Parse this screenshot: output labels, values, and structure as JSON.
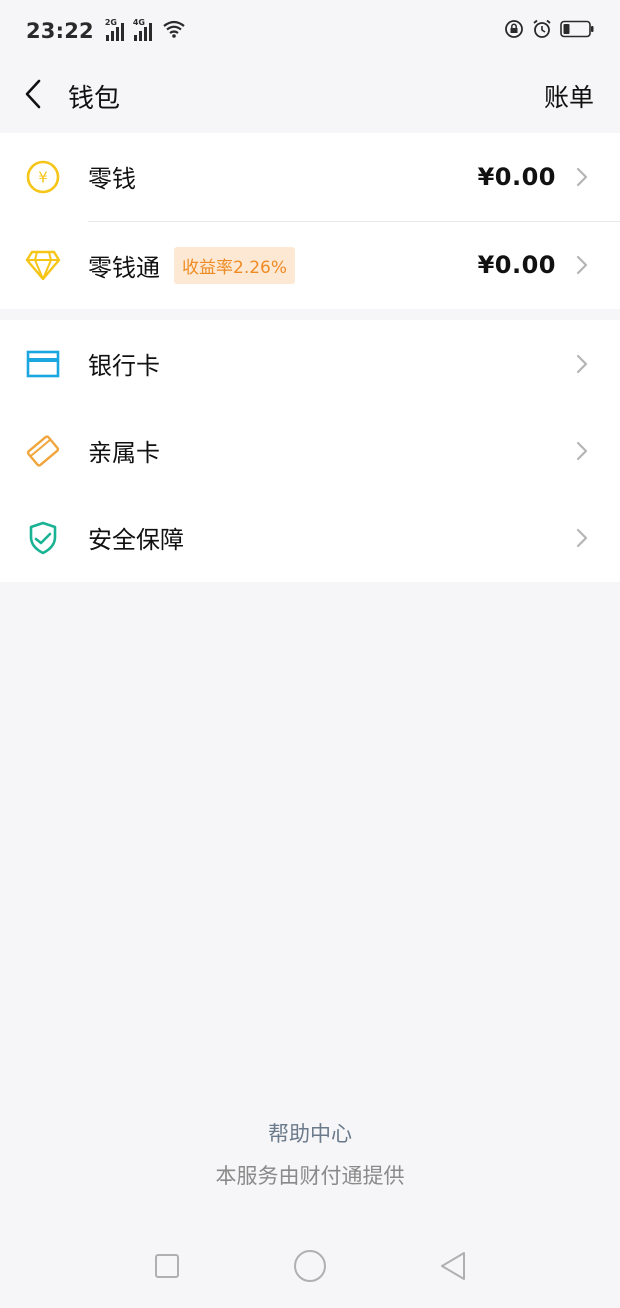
{
  "status_bar": {
    "time": "23:22",
    "sim1_tag": "2G",
    "sim2_tag": "4G"
  },
  "header": {
    "title": "钱包",
    "bill_label": "账单"
  },
  "balance_section": [
    {
      "label": "零钱",
      "amount": "¥0.00",
      "icon": "yen-coin-icon"
    },
    {
      "label": "零钱通",
      "tag": "收益率2.26%",
      "amount": "¥0.00",
      "icon": "diamond-icon"
    }
  ],
  "menu_section": [
    {
      "label": "银行卡",
      "icon": "bank-card-icon"
    },
    {
      "label": "亲属卡",
      "icon": "family-card-icon"
    },
    {
      "label": "安全保障",
      "icon": "shield-icon"
    }
  ],
  "footer": {
    "help_label": "帮助中心",
    "provider_text": "本服务由财付通提供"
  },
  "colors": {
    "coin": "#f5c518",
    "diamond": "#f5c518",
    "bank_card": "#1aa7e0",
    "family_card": "#f0a63c",
    "shield": "#19b394",
    "tag_bg": "#fde9d3",
    "tag_text": "#f08a24"
  }
}
